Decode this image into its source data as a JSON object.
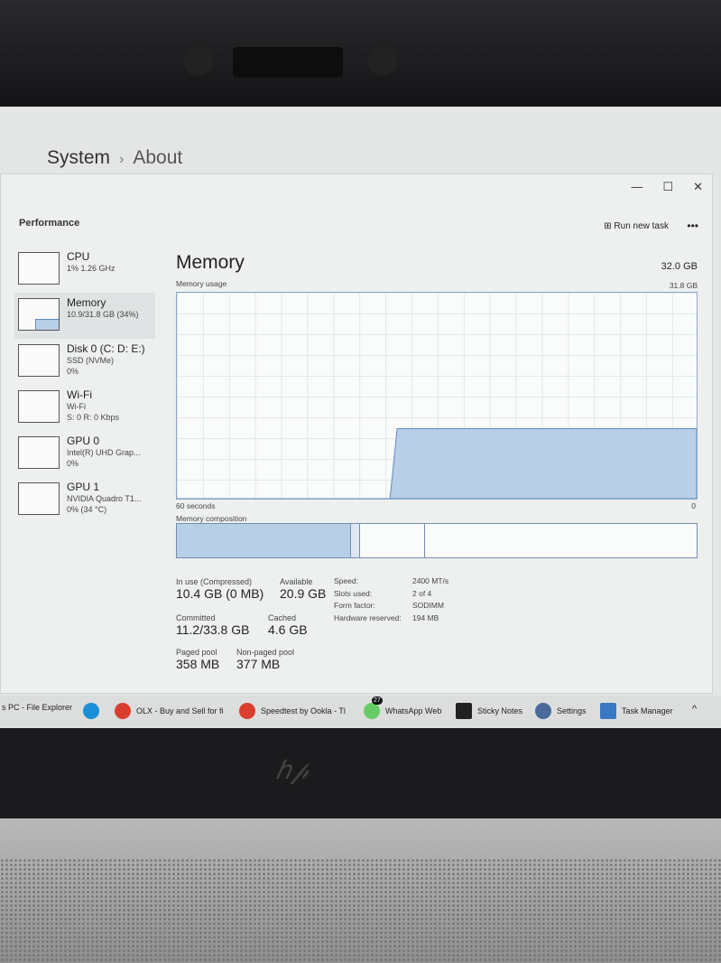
{
  "settings": {
    "crumb_parent": "System",
    "crumb_current": "About"
  },
  "window": {
    "minimize": "—",
    "maximize": "☐",
    "close": "✕",
    "title": "Performance",
    "run_new_task": "Run new task",
    "more": "•••"
  },
  "sidebar": {
    "items": [
      {
        "name": "CPU",
        "line1": "1% 1.26 GHz",
        "line2": ""
      },
      {
        "name": "Memory",
        "line1": "10.9/31.8 GB (34%)",
        "line2": ""
      },
      {
        "name": "Disk 0 (C: D: E:)",
        "line1": "SSD (NVMe)",
        "line2": "0%"
      },
      {
        "name": "Wi-Fi",
        "line1": "Wi-Fi",
        "line2": "S: 0 R: 0 Kbps"
      },
      {
        "name": "GPU 0",
        "line1": "Intel(R) UHD Grap...",
        "line2": "0%"
      },
      {
        "name": "GPU 1",
        "line1": "NVIDIA Quadro T1...",
        "line2": "0% (34 °C)"
      }
    ]
  },
  "memory": {
    "title": "Memory",
    "total": "32.0 GB",
    "usage_label": "Memory usage",
    "usage_max": "31.8 GB",
    "time_label": "60 seconds",
    "time_end": "0",
    "composition_label": "Memory composition",
    "usage_fraction_now": 0.34,
    "usage_fraction_start": 0,
    "composition_fractions": {
      "in_use": 0.335,
      "modified": 0.017,
      "standby": 0.125
    },
    "accent": "#b8cfe8",
    "line": "#5f8cc0",
    "stats": {
      "in_use_label": "In use (Compressed)",
      "in_use": "10.4 GB (0 MB)",
      "available_label": "Available",
      "available": "20.9 GB",
      "committed_label": "Committed",
      "committed": "11.2/33.8 GB",
      "cached_label": "Cached",
      "cached": "4.6 GB",
      "paged_label": "Paged pool",
      "paged": "358 MB",
      "nonpaged_label": "Non-paged pool",
      "nonpaged": "377 MB",
      "speed_label": "Speed:",
      "speed": "2400 MT/s",
      "slots_label": "Slots used:",
      "slots": "2 of 4",
      "form_label": "Form factor:",
      "form": "SODIMM",
      "hw_label": "Hardware reserved:",
      "hw": "194 MB"
    }
  },
  "taskbar": {
    "items": [
      {
        "label": "s PC - File Explorer",
        "icon": "folder-icon"
      },
      {
        "label": "",
        "icon": "edge-icon"
      },
      {
        "label": "OLX - Buy and Sell for fi",
        "icon": "chrome-icon"
      },
      {
        "label": "Speedtest by Ookla - Tl",
        "icon": "chrome-icon"
      },
      {
        "label": "WhatsApp Web",
        "icon": "whatsapp-icon",
        "badge": "27"
      },
      {
        "label": "Sticky Notes",
        "icon": "sticky-notes-icon"
      },
      {
        "label": "Settings",
        "icon": "gear-icon"
      },
      {
        "label": "Task Manager",
        "icon": "task-manager-icon"
      }
    ],
    "chevron": "^"
  },
  "brand": "hp"
}
